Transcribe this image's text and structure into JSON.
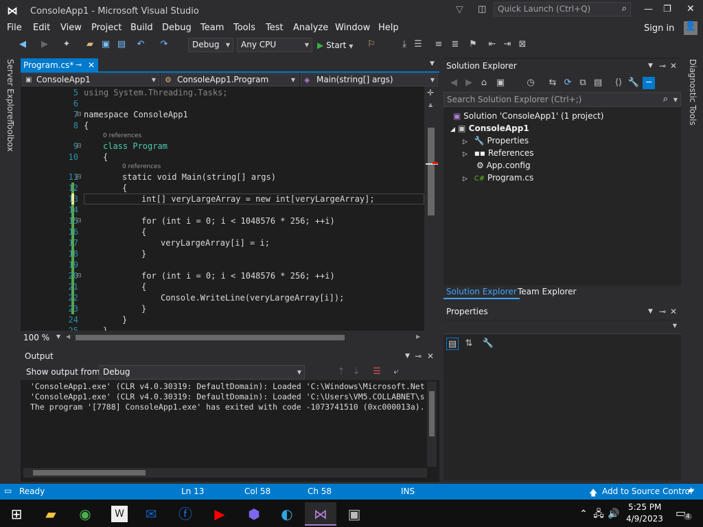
{
  "window": {
    "title": "ConsoleApp1 - Microsoft Visual Studio",
    "quick_launch_placeholder": "Quick Launch (Ctrl+Q)",
    "sign_in": "Sign in"
  },
  "menu": [
    "File",
    "Edit",
    "View",
    "Project",
    "Build",
    "Debug",
    "Team",
    "Tools",
    "Test",
    "Analyze",
    "Window",
    "Help"
  ],
  "toolbar": {
    "config": "Debug",
    "platform": "Any CPU",
    "start_label": "Start"
  },
  "left_tabs": [
    "Server Explorer",
    "Toolbox"
  ],
  "right_tabs": [
    "Diagnostic Tools"
  ],
  "editor": {
    "tab_label": "Program.cs*",
    "nav_project": "ConsoleApp1",
    "nav_class": "ConsoleApp1.Program",
    "nav_member": "Main(string[] args)",
    "zoom": "100 %",
    "refs": "0 references",
    "lines": [
      {
        "n": "5",
        "t": "using System.Threading.Tasks;"
      },
      {
        "n": "6",
        "t": ""
      },
      {
        "n": "7",
        "t": "namespace ConsoleApp1"
      },
      {
        "n": "8",
        "t": "{"
      },
      {
        "n": "9",
        "t": "class Program"
      },
      {
        "n": "10",
        "t": "{"
      },
      {
        "n": "11",
        "t": "static void Main(string[] args)"
      },
      {
        "n": "12",
        "t": "{"
      },
      {
        "n": "13",
        "t": "int[] veryLargeArray = new int[veryLargeArray];"
      },
      {
        "n": "14",
        "t": ""
      },
      {
        "n": "15",
        "t": "for (int i = 0; i < 1048576 * 256; ++i)"
      },
      {
        "n": "16",
        "t": "{"
      },
      {
        "n": "17",
        "t": "veryLargeArray[i] = i;"
      },
      {
        "n": "18",
        "t": "}"
      },
      {
        "n": "19",
        "t": ""
      },
      {
        "n": "20",
        "t": "for (int i = 0; i < 1048576 * 256; ++i)"
      },
      {
        "n": "21",
        "t": "{"
      },
      {
        "n": "22",
        "t": "Console.WriteLine(veryLargeArray[i]);"
      },
      {
        "n": "23",
        "t": "}"
      },
      {
        "n": "24",
        "t": "}"
      },
      {
        "n": "25",
        "t": "}"
      }
    ]
  },
  "output": {
    "title": "Output",
    "show_from_label": "Show output from:",
    "source": "Debug",
    "lines": [
      "'ConsoleApp1.exe' (CLR v4.0.30319: DefaultDomain): Loaded 'C:\\Windows\\Microsoft.Net",
      "'ConsoleApp1.exe' (CLR v4.0.30319: DefaultDomain): Loaded 'C:\\Users\\VM5.COLLABNET\\s",
      "The program '[7788] ConsoleApp1.exe' has exited with code -1073741510 (0xc000013a)."
    ]
  },
  "solution_explorer": {
    "title": "Solution Explorer",
    "search_placeholder": "Search Solution Explorer (Ctrl+;)",
    "solution": "Solution 'ConsoleApp1' (1 project)",
    "project": "ConsoleApp1",
    "items": [
      "Properties",
      "References",
      "App.config",
      "Program.cs"
    ],
    "tabs": [
      "Solution Explorer",
      "Team Explorer"
    ]
  },
  "properties": {
    "title": "Properties"
  },
  "status": {
    "ready": "Ready",
    "ln": "Ln 13",
    "col": "Col 58",
    "ch": "Ch 58",
    "mode": "INS",
    "source_control": "Add to Source Control"
  },
  "taskbar": {
    "time": "5:25 PM",
    "date": "4/9/2023",
    "notifications": "4"
  },
  "colors": {
    "accent": "#007acc",
    "editor_bg": "#1e1e1e",
    "chrome": "#2d2d30"
  }
}
